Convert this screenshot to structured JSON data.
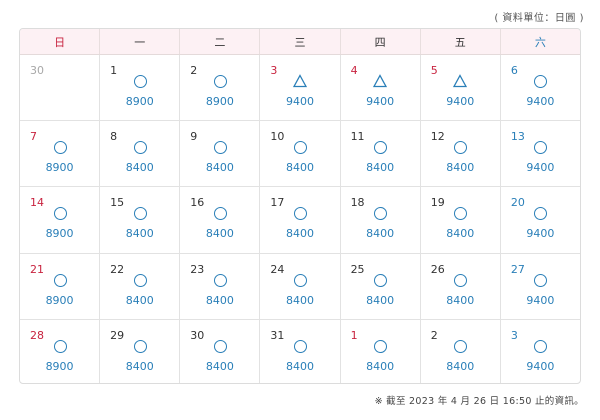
{
  "unit_note": "( 資料單位：日圓 )",
  "weekdays": [
    "日",
    "一",
    "二",
    "三",
    "四",
    "五",
    "六"
  ],
  "colors": {
    "sunday": "#c8233f",
    "saturday": "#2a7fb8",
    "symbol": "#2a7fb8",
    "past": "#a8a8a8",
    "header_bg": "#fdf1f4"
  },
  "weeks": [
    [
      {
        "day": "30",
        "symbol": "",
        "price": "",
        "past": true
      },
      {
        "day": "1",
        "symbol": "circle",
        "price": "8900"
      },
      {
        "day": "2",
        "symbol": "circle",
        "price": "8900"
      },
      {
        "day": "3",
        "symbol": "triangle",
        "price": "9400",
        "holiday": true
      },
      {
        "day": "4",
        "symbol": "triangle",
        "price": "9400",
        "holiday": true
      },
      {
        "day": "5",
        "symbol": "triangle",
        "price": "9400",
        "holiday": true
      },
      {
        "day": "6",
        "symbol": "circle",
        "price": "9400"
      }
    ],
    [
      {
        "day": "7",
        "symbol": "circle",
        "price": "8900"
      },
      {
        "day": "8",
        "symbol": "circle",
        "price": "8400"
      },
      {
        "day": "9",
        "symbol": "circle",
        "price": "8400"
      },
      {
        "day": "10",
        "symbol": "circle",
        "price": "8400"
      },
      {
        "day": "11",
        "symbol": "circle",
        "price": "8400"
      },
      {
        "day": "12",
        "symbol": "circle",
        "price": "8400"
      },
      {
        "day": "13",
        "symbol": "circle",
        "price": "9400"
      }
    ],
    [
      {
        "day": "14",
        "symbol": "circle",
        "price": "8900"
      },
      {
        "day": "15",
        "symbol": "circle",
        "price": "8400"
      },
      {
        "day": "16",
        "symbol": "circle",
        "price": "8400"
      },
      {
        "day": "17",
        "symbol": "circle",
        "price": "8400"
      },
      {
        "day": "18",
        "symbol": "circle",
        "price": "8400"
      },
      {
        "day": "19",
        "symbol": "circle",
        "price": "8400"
      },
      {
        "day": "20",
        "symbol": "circle",
        "price": "9400"
      }
    ],
    [
      {
        "day": "21",
        "symbol": "circle",
        "price": "8900"
      },
      {
        "day": "22",
        "symbol": "circle",
        "price": "8400"
      },
      {
        "day": "23",
        "symbol": "circle",
        "price": "8400"
      },
      {
        "day": "24",
        "symbol": "circle",
        "price": "8400"
      },
      {
        "day": "25",
        "symbol": "circle",
        "price": "8400"
      },
      {
        "day": "26",
        "symbol": "circle",
        "price": "8400"
      },
      {
        "day": "27",
        "symbol": "circle",
        "price": "9400"
      }
    ],
    [
      {
        "day": "28",
        "symbol": "circle",
        "price": "8900"
      },
      {
        "day": "29",
        "symbol": "circle",
        "price": "8400"
      },
      {
        "day": "30",
        "symbol": "circle",
        "price": "8400"
      },
      {
        "day": "31",
        "symbol": "circle",
        "price": "8400"
      },
      {
        "day": "1",
        "symbol": "circle",
        "price": "8400",
        "holiday": true
      },
      {
        "day": "2",
        "symbol": "circle",
        "price": "8400"
      },
      {
        "day": "3",
        "symbol": "circle",
        "price": "9400"
      }
    ]
  ],
  "footer_note": "※ 截至 2023 年 4 月 26 日 16:50 止的資訊。"
}
